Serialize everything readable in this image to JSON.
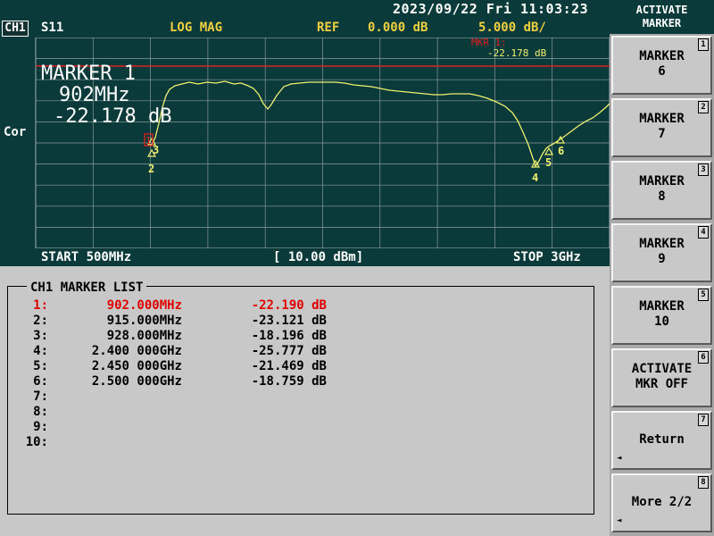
{
  "status": {
    "datetime": "2023/09/22 Fri 11:03:23"
  },
  "header": {
    "channel": "CH1",
    "param": "S11",
    "format": "LOG MAG",
    "ref_label": "REF",
    "ref_value": "0.000 dB",
    "scale": "5.000 dB/"
  },
  "plot": {
    "cor_label": "Cor",
    "marker_readout": {
      "title": "MARKER 1",
      "freq": "902MHz",
      "value": "-22.178 dB"
    },
    "mkr_top": {
      "label": "MKR 1:",
      "value": "-22.178 dB"
    },
    "marker_tags": [
      "2",
      "3",
      "4",
      "5",
      "6"
    ],
    "ref_marker_tag": "1",
    "colors": {
      "trace": "#f0f070",
      "ref_line": "#e02020",
      "grid": "#8a9a9a",
      "bg": "#0a3a3a"
    }
  },
  "footer": {
    "start": "START 500MHz",
    "power": "[ 10.00 dBm]",
    "stop": "STOP 3GHz"
  },
  "marker_list": {
    "title": "CH1 MARKER LIST",
    "rows": [
      {
        "num": "1:",
        "freq": "902.000MHz",
        "val": "-22.190 dB",
        "active": true
      },
      {
        "num": "2:",
        "freq": "915.000MHz",
        "val": "-23.121 dB",
        "active": false
      },
      {
        "num": "3:",
        "freq": "928.000MHz",
        "val": "-18.196 dB",
        "active": false
      },
      {
        "num": "4:",
        "freq": "2.400 000GHz",
        "val": "-25.777 dB",
        "active": false
      },
      {
        "num": "5:",
        "freq": "2.450 000GHz",
        "val": "-21.469 dB",
        "active": false
      },
      {
        "num": "6:",
        "freq": "2.500 000GHz",
        "val": "-18.759 dB",
        "active": false
      },
      {
        "num": "7:",
        "freq": "",
        "val": "",
        "active": false
      },
      {
        "num": "8:",
        "freq": "",
        "val": "",
        "active": false
      },
      {
        "num": "9:",
        "freq": "",
        "val": "",
        "active": false
      },
      {
        "num": "10:",
        "freq": "",
        "val": "",
        "active": false
      }
    ]
  },
  "softkeys": {
    "title": "ACTIVATE\nMARKER",
    "keys": [
      {
        "label": "MARKER\n6",
        "num": "1"
      },
      {
        "label": "MARKER\n7",
        "num": "2"
      },
      {
        "label": "MARKER\n8",
        "num": "3"
      },
      {
        "label": "MARKER\n9",
        "num": "4"
      },
      {
        "label": "MARKER\n10",
        "num": "5"
      },
      {
        "label": "ACTIVATE\nMKR OFF",
        "num": "6"
      },
      {
        "label": "Return",
        "num": "7",
        "arrow": "◄"
      },
      {
        "label": "More 2/2",
        "num": "8",
        "arrow": "◄"
      }
    ]
  }
}
